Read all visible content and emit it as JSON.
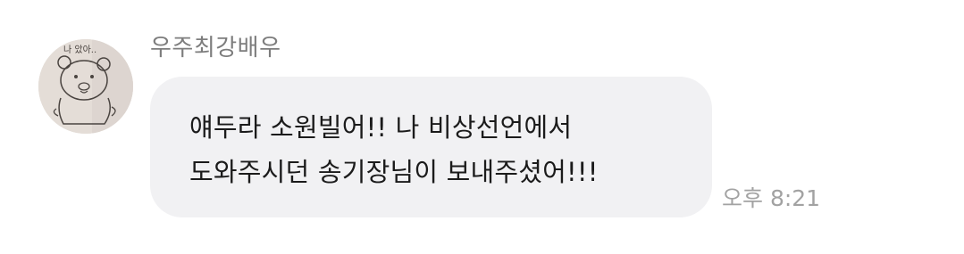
{
  "message": {
    "sender_name": "우주최강배우",
    "avatar_doodle_text": "나 았아..",
    "lines": [
      "얘두라 소원빌어!! 나 비상선언에서",
      "도와주시던 송기장님이 보내주셨어!!!"
    ],
    "time": "오후 8:21"
  },
  "colors": {
    "bubble_bg": "#f1f1f3",
    "name_text": "#7d7d7d",
    "time_text": "#a2a2a2",
    "message_text": "#1b1b1b"
  }
}
